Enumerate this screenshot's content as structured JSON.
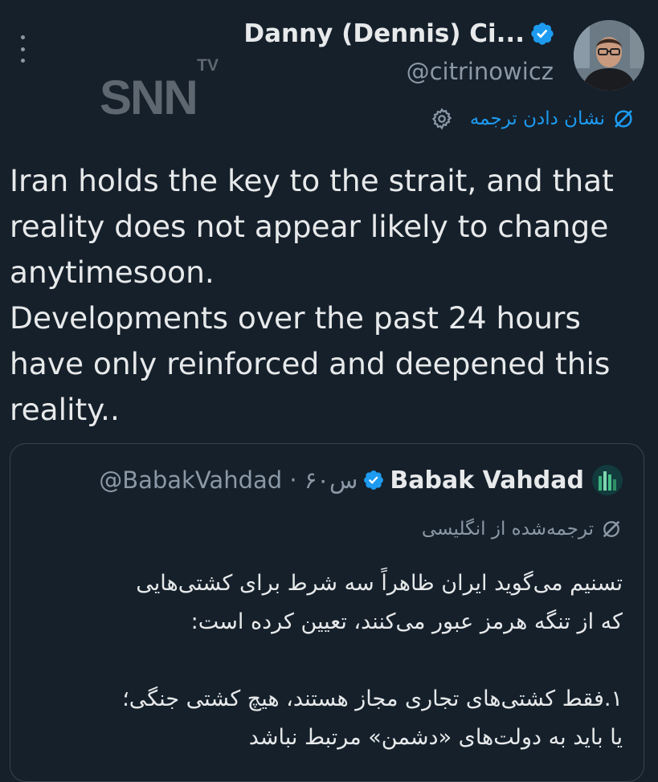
{
  "author": {
    "display_name": "Danny (Dennis) Ci...",
    "handle": "@citrinowicz",
    "verified": true,
    "avatar": "avatar-photo"
  },
  "watermark": {
    "small": "TV",
    "large": "SNN"
  },
  "translate": {
    "label": "نشان دادن ترجمه",
    "icon": "globe-slash-icon",
    "settings_icon": "gear-icon"
  },
  "tweet": {
    "lines": [
      "Iran holds the key to the strait, and that",
      "reality does not appear likely to change",
      "anytimesoon.",
      "Developments over the past 24 hours",
      "have only reinforced and deepened this",
      "reality.."
    ]
  },
  "quote": {
    "display_name": "Babak Vahdad",
    "handle": "@BabakVahdad",
    "separator": "·",
    "time": "۶۰س",
    "verified": true,
    "translated_label": "ترجمه‌شده از انگلیسی",
    "body_lines": [
      "تسنیم می‌گوید ایران ظاهراً سه شرط برای کشتی‌هایی",
      "که از تنگه هرمز عبور می‌کنند، تعیین کرده است:",
      "",
      "۱.فقط کشتی‌های تجاری مجاز هستند، هیچ کشتی جنگی؛",
      "یا باید به دولت‌های «دشمن» مرتبط نباشد"
    ]
  },
  "colors": {
    "background": "#15202b",
    "text": "#e7e9ea",
    "secondary": "#8b98a5",
    "accent": "#1d9bf0",
    "border": "#38444d"
  }
}
